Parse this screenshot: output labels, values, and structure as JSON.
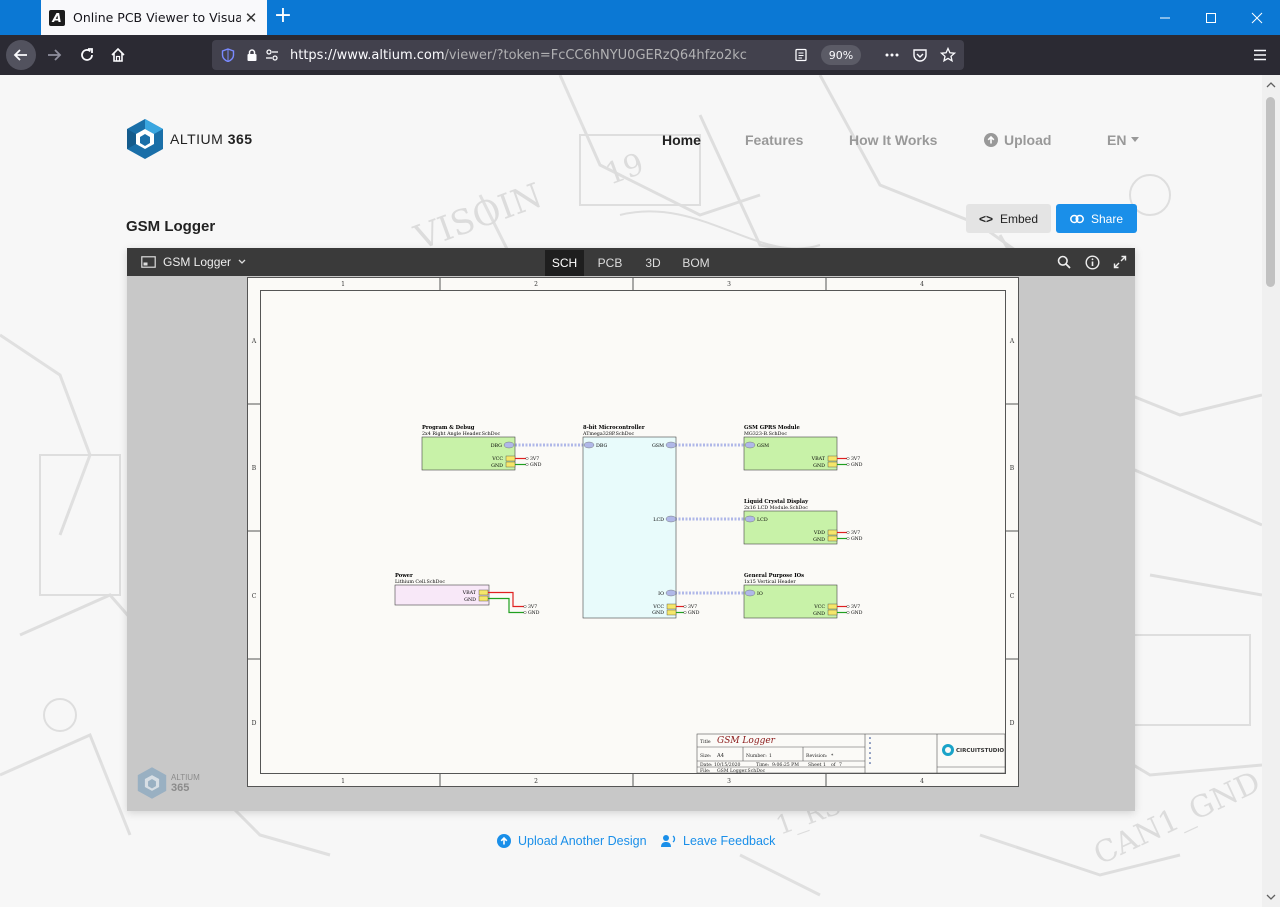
{
  "browser": {
    "tab_title": "Online PCB Viewer to Visualize",
    "url_host": "https://www.altium.com",
    "url_path": "/viewer/?token=FcCC6hNYU0GERzQ64hfzo2kc",
    "zoom": "90%"
  },
  "site": {
    "logo_text_1": "ALTIUM",
    "logo_text_2": "365",
    "nav": [
      {
        "label": "Home",
        "active": true
      },
      {
        "label": "Features"
      },
      {
        "label": "How It Works"
      },
      {
        "label": "Upload"
      },
      {
        "label": "EN"
      }
    ]
  },
  "project": {
    "title": "GSM Logger",
    "embed_label": "Embed",
    "share_label": "Share"
  },
  "viewer": {
    "document": "GSM Logger",
    "tabs": [
      "SCH",
      "PCB",
      "3D",
      "BOM"
    ],
    "active_tab": "SCH",
    "logo_text_1": "ALTIUM",
    "logo_text_2": "365"
  },
  "schematic": {
    "col_labels": [
      "1",
      "2",
      "3",
      "4"
    ],
    "row_labels": [
      "A",
      "B",
      "C",
      "D"
    ],
    "blocks": [
      {
        "title": "Program & Debug",
        "file": "2x4 Right Angle Header.SchDoc",
        "ports": [
          "DBG",
          "VCC",
          "GND"
        ],
        "nets": [
          "3V7",
          "GND"
        ]
      },
      {
        "title": "8-bit Microcontroller",
        "file": "ATmega328P.SchDoc",
        "ports": [
          "DBG",
          "GSM",
          "LCD",
          "IO",
          "VCC",
          "GND"
        ],
        "nets": [
          "3V7",
          "GND"
        ]
      },
      {
        "title": "GSM GPRS Module",
        "file": "MG323-B.SchDoc",
        "ports": [
          "GSM",
          "VBAT",
          "GND"
        ],
        "nets": [
          "3V7",
          "GND"
        ]
      },
      {
        "title": "Liquid Crystal Display",
        "file": "2x16 LCD Module.SchDoc",
        "ports": [
          "LCD",
          "VDD",
          "GND"
        ],
        "nets": [
          "3V7",
          "GND"
        ]
      },
      {
        "title": "General Purpose IOs",
        "file": "1x15 Vertical Header",
        "ports": [
          "IO",
          "VCC",
          "GND"
        ],
        "nets": [
          "3V7",
          "GND"
        ]
      },
      {
        "title": "Power",
        "file": "Lithium Cell.SchDoc",
        "ports": [
          "VBAT",
          "GND"
        ],
        "nets": [
          "3V7",
          "GND"
        ]
      }
    ],
    "title_block": {
      "title_label": "Title",
      "title": "GSM Logger",
      "size_label": "Size:",
      "size": "A4",
      "number_label": "Number:",
      "number": "1",
      "revision_label": "Revision:",
      "revision": "*",
      "date_label": "Date:",
      "date": "10/15/2020",
      "time_label": "Time:",
      "time": "9:06:25 PM",
      "sheet_label": "Sheet",
      "sheet": "1",
      "of_label": "of",
      "sheet_total": "7",
      "file_label": "File:",
      "file": "GSM Logger.SchDoc",
      "brand": "CIRCUITSTUDIO"
    }
  },
  "footer": {
    "upload_another": "Upload Another Design",
    "feedback": "Leave Feedback"
  },
  "background_text": [
    "VISOIN",
    "19",
    "CAN1_GND",
    "1_RS"
  ]
}
